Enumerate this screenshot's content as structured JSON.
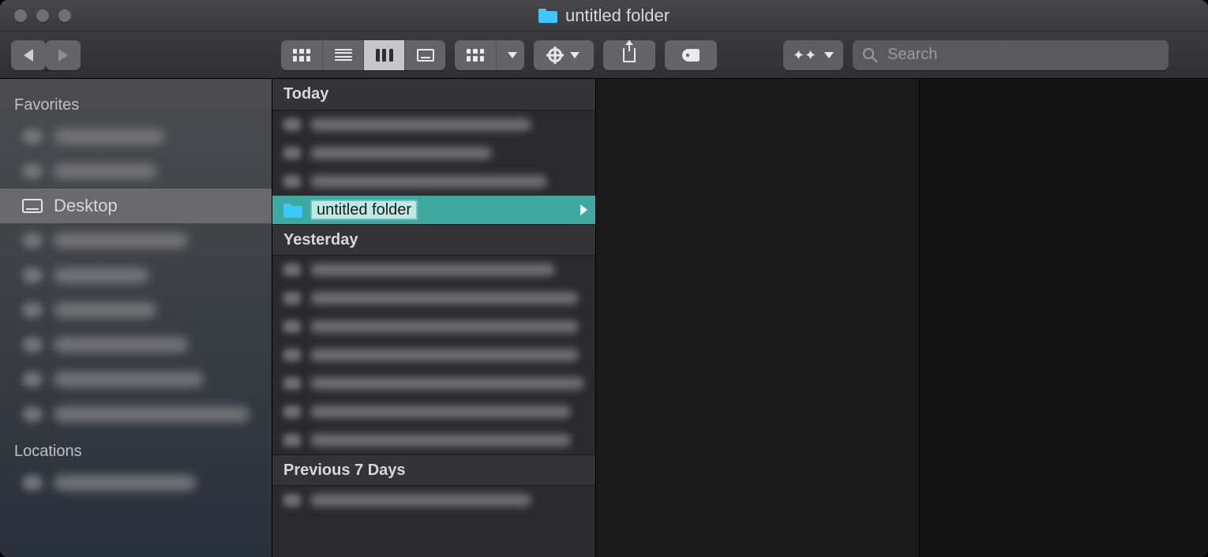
{
  "window": {
    "title": "untitled folder"
  },
  "toolbar": {
    "search_placeholder": "Search"
  },
  "sidebar": {
    "sections": [
      {
        "title": "Favorites"
      },
      {
        "title": "Locations"
      }
    ],
    "desktop_label": "Desktop"
  },
  "column": {
    "groups": [
      {
        "title": "Today"
      },
      {
        "title": "Yesterday"
      },
      {
        "title": "Previous 7 Days"
      }
    ],
    "selected_name": "untitled folder"
  }
}
